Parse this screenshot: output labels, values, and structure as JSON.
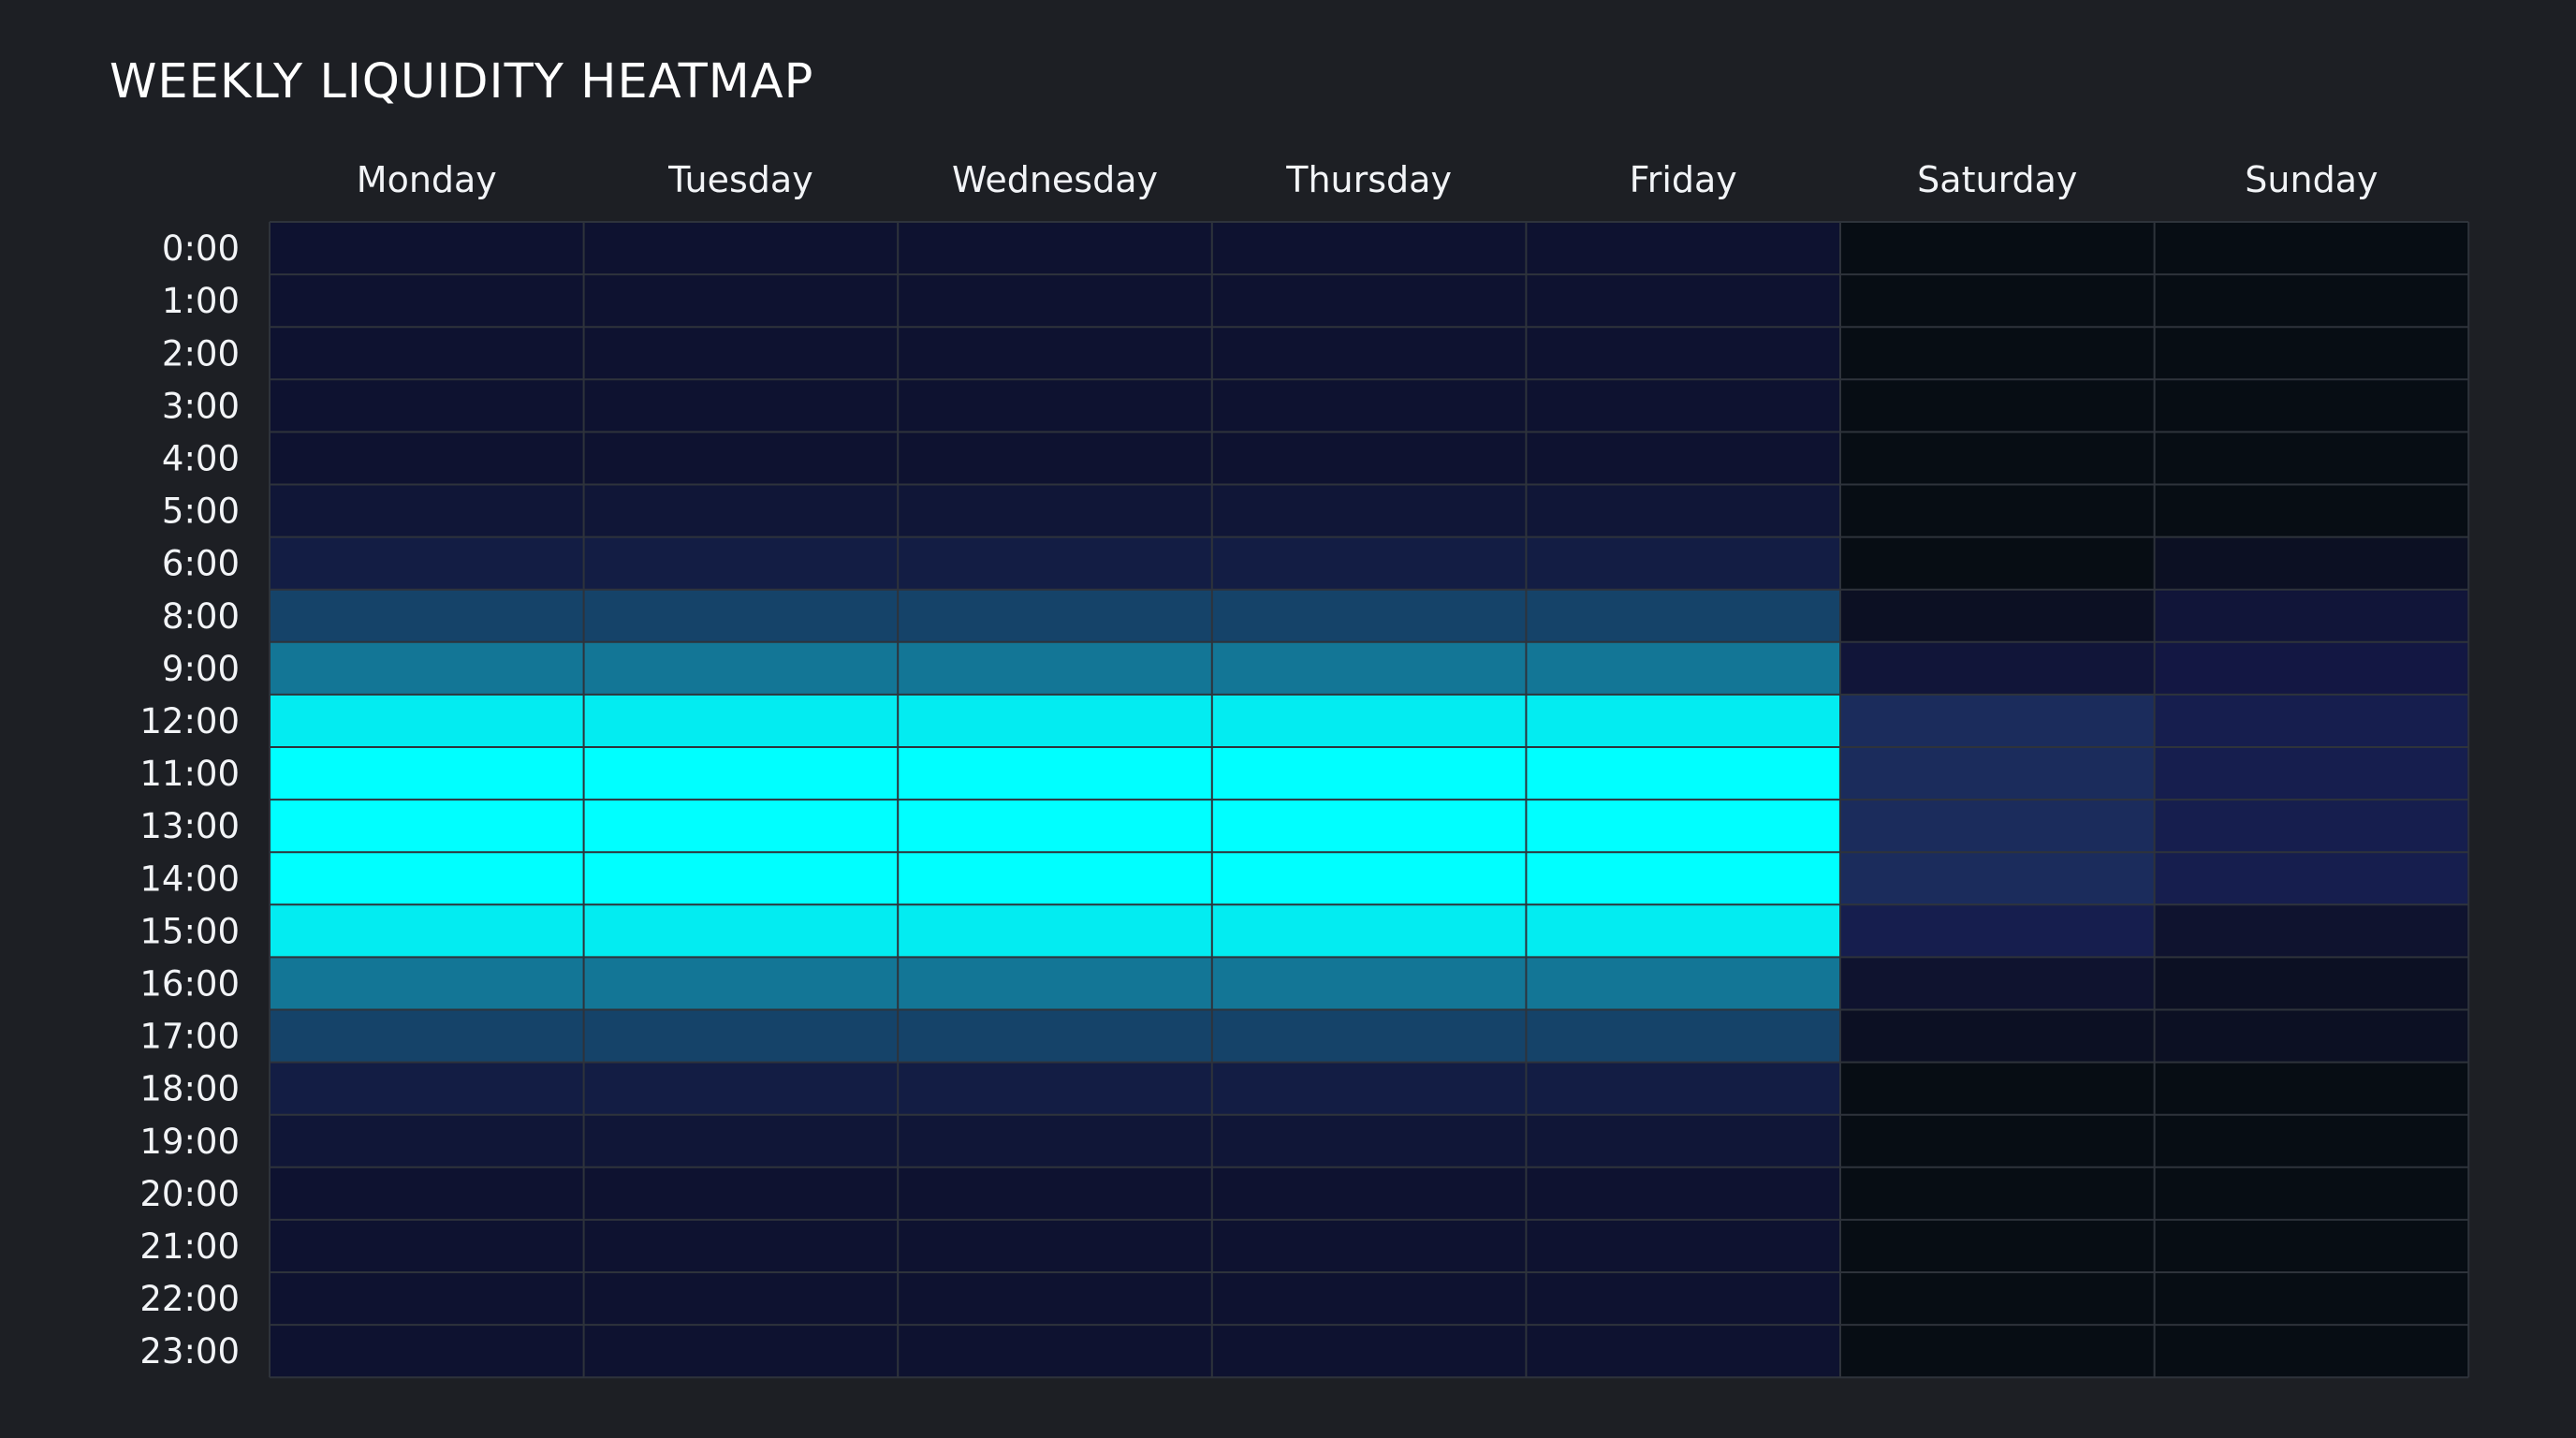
{
  "chart_data": {
    "type": "heatmap",
    "title": "WEEKLY LIQUIDITY HEATMAP",
    "columns": [
      "Monday",
      "Tuesday",
      "Wednesday",
      "Thursday",
      "Friday",
      "Saturday",
      "Sunday"
    ],
    "rows": [
      "0:00",
      "1:00",
      "2:00",
      "3:00",
      "4:00",
      "5:00",
      "6:00",
      "8:00",
      "9:00",
      "12:00",
      "11:00",
      "13:00",
      "14:00",
      "15:00",
      "16:00",
      "17:00",
      "18:00",
      "19:00",
      "20:00",
      "21:00",
      "22:00",
      "23:00"
    ],
    "values": [
      [
        0.05,
        0.05,
        0.05,
        0.05,
        0.05,
        0.0,
        0.0
      ],
      [
        0.05,
        0.05,
        0.05,
        0.05,
        0.05,
        0.0,
        0.0
      ],
      [
        0.05,
        0.05,
        0.05,
        0.05,
        0.05,
        0.0,
        0.0
      ],
      [
        0.05,
        0.05,
        0.05,
        0.05,
        0.05,
        0.0,
        0.0
      ],
      [
        0.05,
        0.05,
        0.05,
        0.05,
        0.05,
        0.0,
        0.0
      ],
      [
        0.1,
        0.1,
        0.1,
        0.1,
        0.1,
        0.0,
        0.0
      ],
      [
        0.2,
        0.2,
        0.2,
        0.2,
        0.2,
        0.0,
        0.05
      ],
      [
        0.4,
        0.4,
        0.4,
        0.4,
        0.4,
        0.05,
        0.1
      ],
      [
        0.6,
        0.6,
        0.6,
        0.6,
        0.6,
        0.1,
        0.12
      ],
      [
        0.95,
        0.95,
        0.95,
        0.95,
        0.95,
        0.2,
        0.15
      ],
      [
        1.0,
        1.0,
        1.0,
        1.0,
        1.0,
        0.2,
        0.15
      ],
      [
        1.0,
        1.0,
        1.0,
        1.0,
        1.0,
        0.2,
        0.15
      ],
      [
        1.0,
        1.0,
        1.0,
        1.0,
        1.0,
        0.2,
        0.15
      ],
      [
        0.95,
        0.95,
        0.95,
        0.95,
        0.95,
        0.15,
        0.08
      ],
      [
        0.6,
        0.6,
        0.6,
        0.6,
        0.6,
        0.08,
        0.05
      ],
      [
        0.4,
        0.4,
        0.4,
        0.4,
        0.4,
        0.05,
        0.05
      ],
      [
        0.2,
        0.2,
        0.2,
        0.2,
        0.2,
        0.0,
        0.0
      ],
      [
        0.1,
        0.1,
        0.1,
        0.1,
        0.1,
        0.0,
        0.0
      ],
      [
        0.05,
        0.05,
        0.05,
        0.05,
        0.05,
        0.0,
        0.0
      ],
      [
        0.05,
        0.05,
        0.05,
        0.05,
        0.05,
        0.0,
        0.0
      ],
      [
        0.05,
        0.05,
        0.05,
        0.05,
        0.05,
        0.0,
        0.0
      ],
      [
        0.05,
        0.05,
        0.05,
        0.05,
        0.05,
        0.0,
        0.0
      ]
    ],
    "color_scale": {
      "weekday": [
        "#0d0f2a",
        "#14204a",
        "#155a7d",
        "#0f9fbb",
        "#00ffff"
      ],
      "weekend": [
        "#070d14",
        "#0d1128",
        "#15194a",
        "#1b2c5c"
      ]
    },
    "legend": "none",
    "grid": true
  }
}
